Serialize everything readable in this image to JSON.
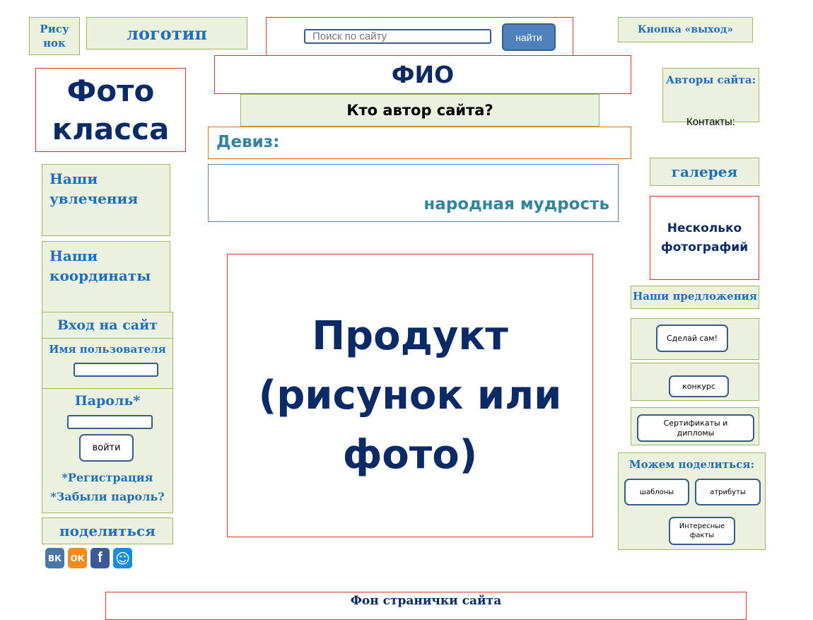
{
  "header": {
    "picture_label": "Рису нок",
    "logo_label": "логотип",
    "search_placeholder": "Поиск по сайту",
    "search_button": "найти",
    "exit_button": "Кнопка «выход»"
  },
  "center": {
    "fio": "ФИО",
    "who_author": "Кто автор сайта?",
    "motto": "Девиз:",
    "wisdom": "народная мудрость",
    "product": "Продукт (рисунок или фото)",
    "footer": "Фон странички сайта"
  },
  "left": {
    "class_photo": "Фото класса",
    "hobbies": "Наши увлечения",
    "coordinates": "Наши координаты",
    "login_title": "Вход на сайт",
    "username_label": "Имя пользователя",
    "password_label": "Пароль*",
    "login_button": "войти",
    "register_link": "*Регистрация",
    "forgot_link": "*Забыли пароль?",
    "share_label": "поделиться",
    "social": [
      "ВК",
      "ОК",
      "f",
      "☺"
    ]
  },
  "right": {
    "authors": "Авторы сайта:",
    "contacts": "Контакты:",
    "gallery": "галерея",
    "several_photos": "Несколько фотографий",
    "offers_title": "Наши предложения",
    "diy_button": "Сделай сам!",
    "contest_button": "конкурс",
    "certificates_button": "Сертификаты и дипломы",
    "share_title": "Можем поделиться:",
    "templates_button": "шаблоны",
    "attributes_button": "атрибуты",
    "facts_button": "Интересные факты"
  },
  "colors": {
    "panel_fill": "#ebf1de",
    "panel_border": "#9bbb59",
    "red_border": "#e0302a",
    "heading_blue": "#1f6fbf",
    "navy": "#0c2a66",
    "teal": "#31859c",
    "button_border": "#385d8a",
    "search_button_fill": "#4f81bd"
  }
}
